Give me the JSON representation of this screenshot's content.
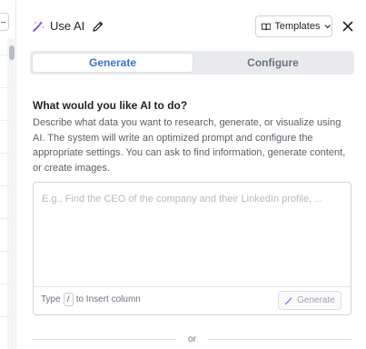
{
  "header": {
    "title": "Use AI",
    "templates_label": "Templates",
    "icons": [
      "magic-wand-icon",
      "pencil-icon",
      "book-icon",
      "chevron-down-icon",
      "close-icon"
    ]
  },
  "tabs": [
    {
      "label": "Generate",
      "active": true
    },
    {
      "label": "Configure",
      "active": false
    }
  ],
  "form": {
    "question": "What would you like AI to do?",
    "description": "Describe what data you want to research, generate, or visualize using AI. The system will write an optimized prompt and configure the appropriate settings. You can ask to find information, generate content, or create images.",
    "prompt_placeholder": "E.g., Find the CEO of the company and their LinkedIn profile, ...",
    "prompt_value": "",
    "hint_prefix": "Type",
    "hint_key": "/",
    "hint_suffix": "to Insert column",
    "generate_label": "Generate"
  },
  "divider": {
    "label": "or"
  },
  "colors": {
    "accent": "#3b6fd4",
    "wand_purple": "#7c3aed",
    "tab_track": "#e8eaed",
    "muted_text": "#5a6068"
  }
}
